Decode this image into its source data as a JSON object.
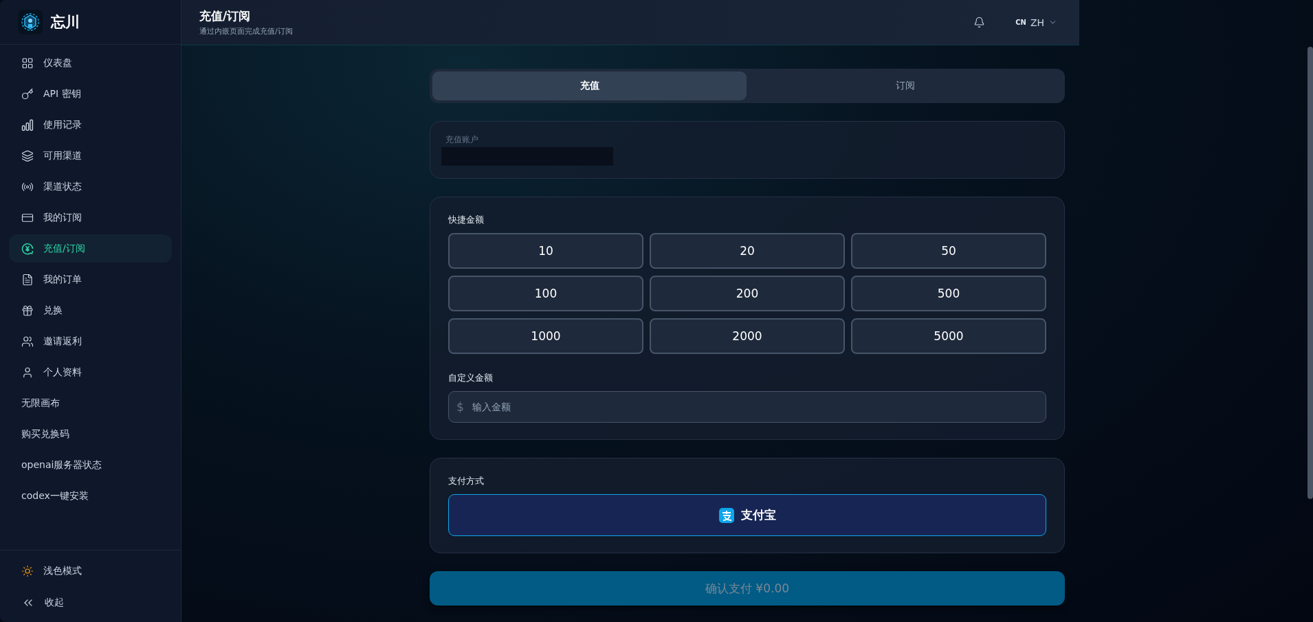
{
  "sidebar": {
    "brand": "忘川",
    "items": [
      {
        "kind": "nav",
        "label": "仪表盘",
        "selected": false
      },
      {
        "kind": "nav",
        "label": "API 密钥",
        "selected": false
      },
      {
        "kind": "nav",
        "label": "使用记录",
        "selected": false
      },
      {
        "kind": "nav",
        "label": "可用渠道",
        "selected": false
      },
      {
        "kind": "nav",
        "label": "渠道状态",
        "selected": false
      },
      {
        "kind": "nav",
        "label": "我的订阅",
        "selected": false
      },
      {
        "kind": "nav",
        "label": "充值/订阅",
        "selected": true
      },
      {
        "kind": "nav",
        "label": "我的订单",
        "selected": false
      },
      {
        "kind": "nav",
        "label": "兑换",
        "selected": false
      },
      {
        "kind": "nav",
        "label": "邀请返利",
        "selected": false
      },
      {
        "kind": "nav",
        "label": "个人资料",
        "selected": false
      },
      {
        "kind": "link",
        "label": "无限画布",
        "selected": false
      },
      {
        "kind": "link",
        "label": "购买兑换码",
        "selected": false
      },
      {
        "kind": "link",
        "label": "openai服务器状态",
        "selected": false
      },
      {
        "kind": "link",
        "label": "codex一键安装",
        "selected": false
      }
    ],
    "footer": [
      {
        "kind": "theme",
        "label": "浅色模式"
      },
      {
        "kind": "collapse",
        "label": "收起"
      }
    ]
  },
  "header": {
    "title": "充值/订阅",
    "subtitle": "通过内嵌页面完成充值/订阅",
    "region": "CN",
    "language": "ZH"
  },
  "tabs": [
    {
      "label": "充值",
      "selected": true
    },
    {
      "label": "订阅",
      "selected": false
    }
  ],
  "account": {
    "label": "充值账户"
  },
  "quick_amounts": {
    "label": "快捷金额",
    "options": [
      {
        "label": "10"
      },
      {
        "label": "20"
      },
      {
        "label": "50"
      },
      {
        "label": "100"
      },
      {
        "label": "200"
      },
      {
        "label": "500"
      },
      {
        "label": "1000"
      },
      {
        "label": "2000"
      },
      {
        "label": "5000"
      }
    ]
  },
  "custom_amount": {
    "label": "自定义金额",
    "prefix": "$",
    "placeholder": "输入金额"
  },
  "payment": {
    "label": "支付方式",
    "methods": [
      {
        "label": "支付宝",
        "selected": true
      }
    ]
  },
  "confirm": {
    "label": "确认支付 ¥0.00",
    "disabled": true
  }
}
